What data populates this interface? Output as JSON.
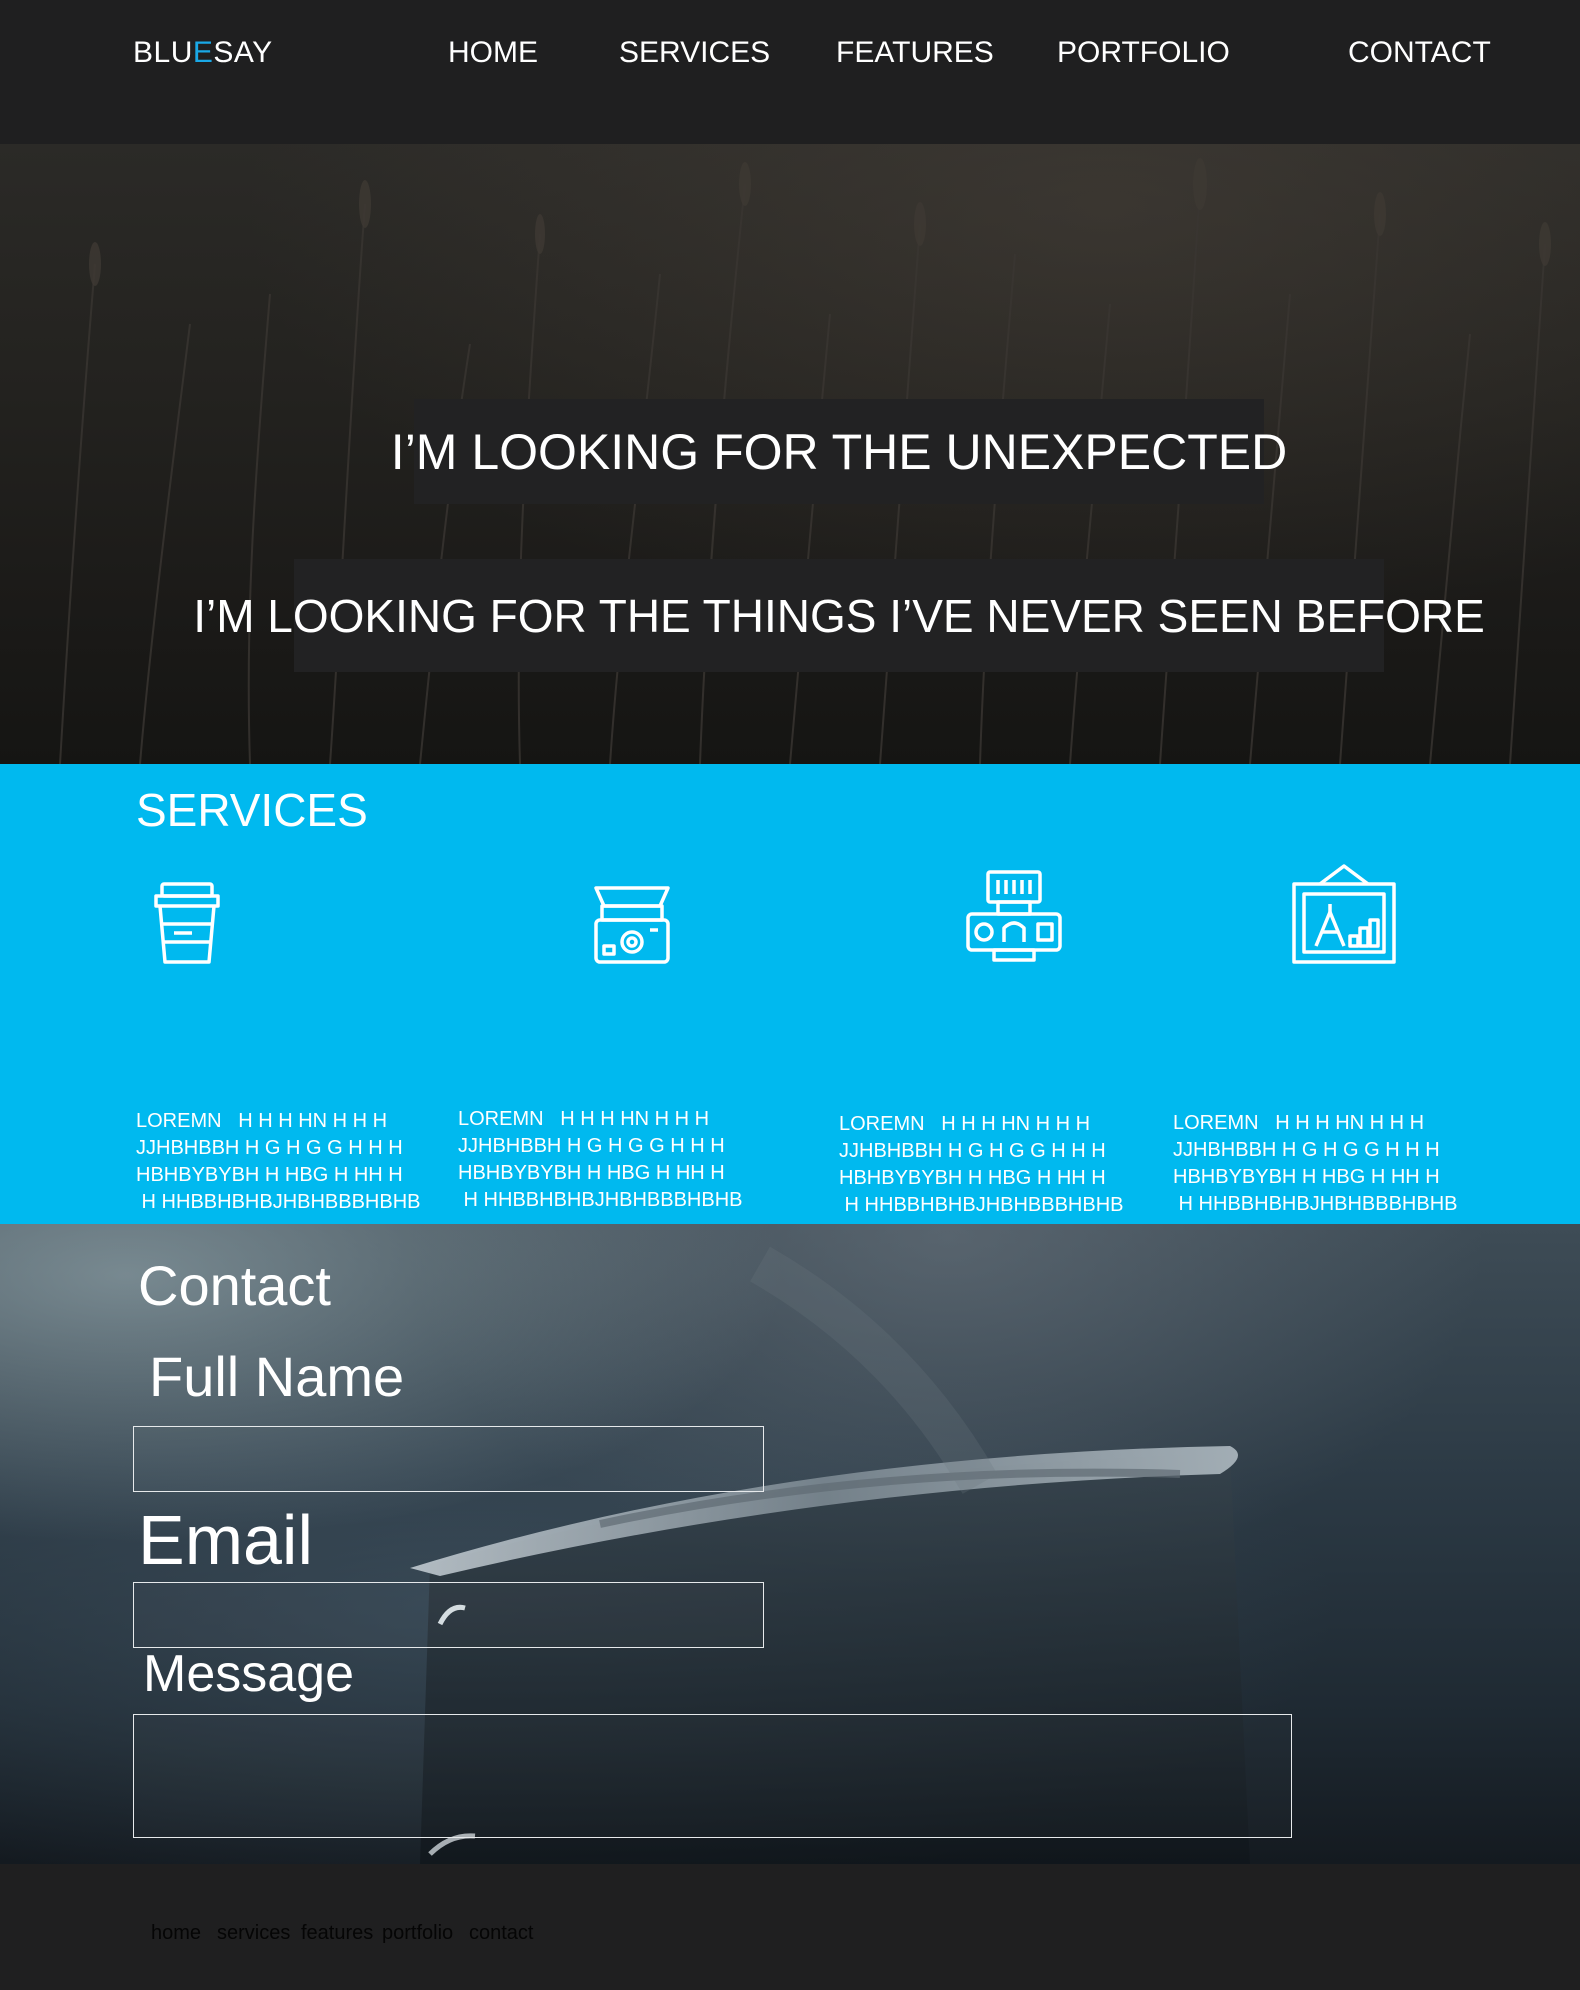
{
  "header": {
    "logo": {
      "part1": "BLU",
      "accent": "E",
      "part2": "SAY"
    },
    "nav": [
      "HOME",
      "SERVICES",
      "FEATURES",
      "PORTFOLIO",
      "CONTACT"
    ]
  },
  "hero": {
    "line1": "I’M  LOOKING FOR THE UNEXPECTED",
    "line2": "I’M  LOOKING FOR THE THINGS I’VE NEVER SEEN BEFORE"
  },
  "services": {
    "title": "SERVICES",
    "icons": [
      "coffee-cup-icon",
      "printer-icon",
      "camera-icon",
      "framed-picture-icon"
    ],
    "items": [
      "LOREMN   H H H HN H H H\nJJHBHBBH H G H G G H H H\nHBHBYBYBH H HBG H HH H\n H HHBBHBHBJHBHBBBHBHB",
      "LOREMN   H H H HN H H H\nJJHBHBBH H G H G G H H H\nHBHBYBYBH H HBG H HH H\n H HHBBHBHBJHBHBBBHBHB",
      "LOREMN   H H H HN H H H\nJJHBHBBH H G H G G H H H\nHBHBYBYBH H HBG H HH H\n H HHBBHBHBJHBHBBBHBHB",
      "LOREMN   H H H HN H H H\nJJHBHBBH H G H G G H H H\nHBHBYBYBH H HBG H HH H\n H HHBBHBHBJHBHBBBHBHB"
    ]
  },
  "contact": {
    "title": "Contact",
    "fullname_label": "Full Name",
    "email_label": "Email",
    "message_label": "Message",
    "fullname_value": "",
    "email_value": "",
    "message_value": ""
  },
  "footer": {
    "links": [
      "home",
      "services",
      "features",
      "portfolio",
      "contact"
    ]
  },
  "colors": {
    "header_bg": "#1f1f20",
    "accent": "#1aa8e6",
    "services_bg": "#00b9ef"
  }
}
